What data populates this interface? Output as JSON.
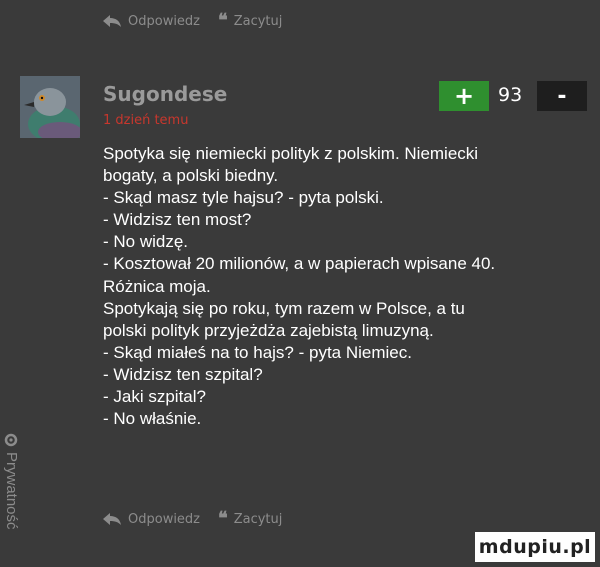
{
  "actions": {
    "reply_label": "Odpowiedz",
    "quote_label": "Zacytuj"
  },
  "comment": {
    "author": "Sugondese",
    "time_ago": "1 dzień temu",
    "votes": {
      "plus_label": "+",
      "score": "93",
      "minus_label": "-"
    },
    "lines": [
      "Spotyka się niemiecki polityk z polskim. Niemiecki",
      "bogaty, a polski biedny.",
      "- Skąd masz tyle hajsu? - pyta polski.",
      "- Widzisz ten most?",
      "- No widzę.",
      "- Kosztował 20 milionów, a w papierach wpisane 40.",
      "Różnica moja.",
      "Spotykają się po roku, tym razem w Polsce, a tu",
      "polski polityk przyjeżdża zajebistą limuzyną.",
      "- Skąd miałeś na to hajs? - pyta Niemiec.",
      "- Widzisz ten szpital?",
      "- Jaki szpital?",
      "- No właśnie."
    ]
  },
  "watermark": {
    "side_text": "Prywatność",
    "logo_text": "mdupiu.pl"
  },
  "colors": {
    "background": "#3a3a3a",
    "time": "#c8372d",
    "plus": "#2f8f2f",
    "minus": "#1e1e1e",
    "muted": "#8c8c8c"
  }
}
